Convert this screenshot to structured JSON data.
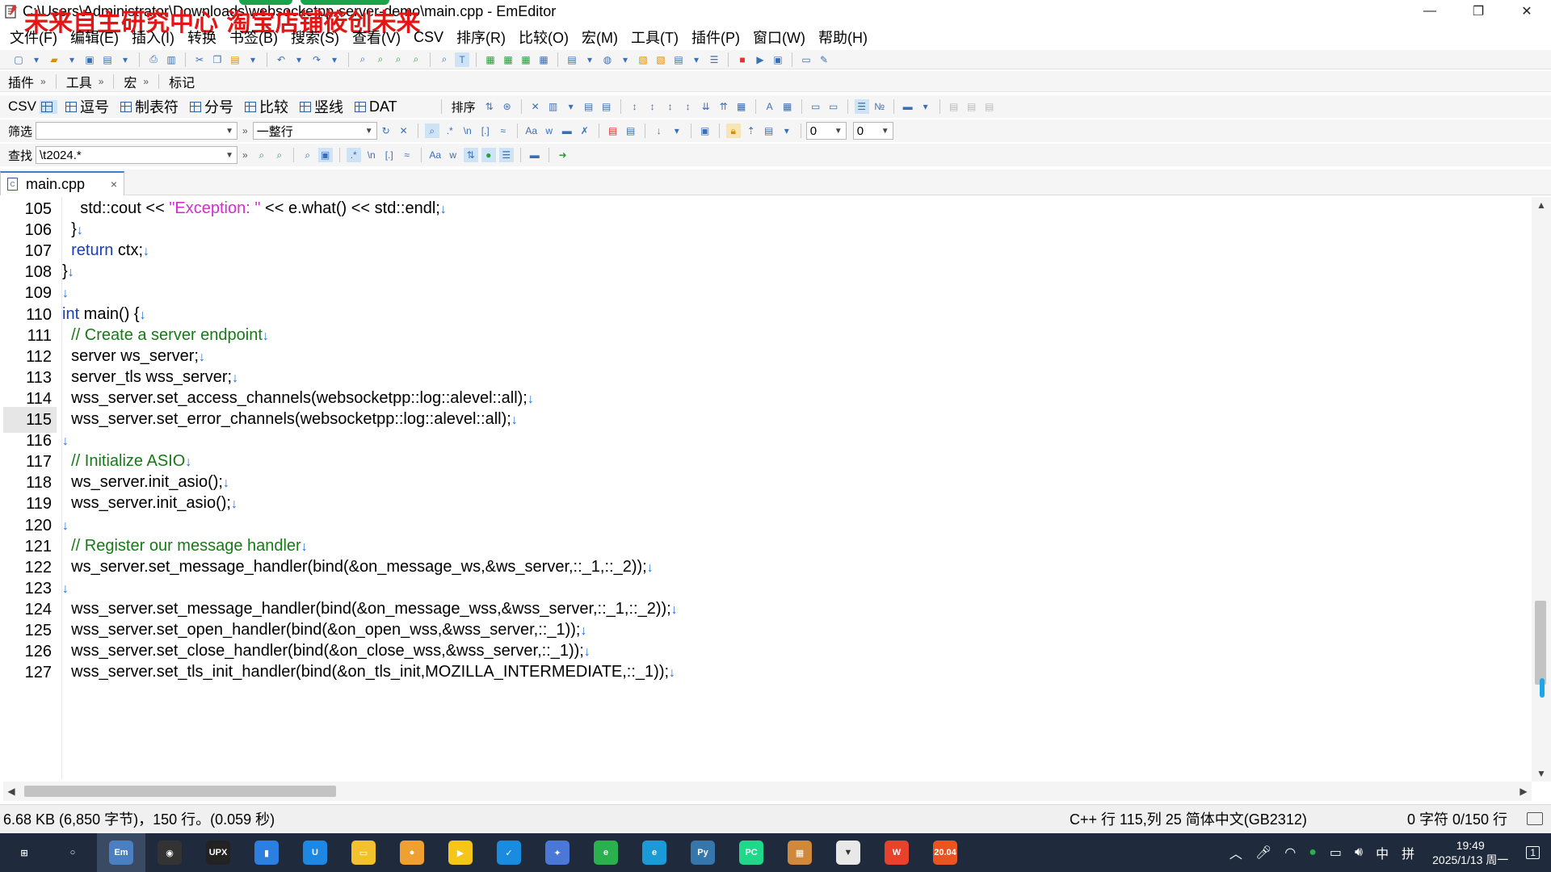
{
  "window": {
    "title": "C:\\Users\\Administrator\\Downloads\\websocketpp-server-demo\\main.cpp - EmEditor",
    "watermark": "未来自主研究中心 淘宝店铺筱创未来",
    "controls": {
      "minimize": "—",
      "restore": "❐",
      "close": "✕"
    }
  },
  "menu": [
    "文件(F)",
    "编辑(E)",
    "插入(I)",
    "转换",
    "书签(B)",
    "搜索(S)",
    "查看(V)",
    "CSV",
    "排序(R)",
    "比较(O)",
    "宏(M)",
    "工具(T)",
    "插件(P)",
    "窗口(W)",
    "帮助(H)"
  ],
  "toolbar2": {
    "plugins": "插件",
    "tools": "工具",
    "macro": "宏",
    "marks": "标记"
  },
  "csvbar": {
    "csv_label": "CSV",
    "items": [
      "逗号",
      "制表符",
      "分号",
      "比较",
      "竖线",
      "DAT"
    ],
    "sort_label": "排序"
  },
  "filter": {
    "label": "筛选",
    "value": "",
    "mode": "一整行",
    "num1": "0",
    "num2": "0"
  },
  "find": {
    "label": "查找",
    "value": "\\t2024.*"
  },
  "tab": {
    "name": "main.cpp"
  },
  "editor": {
    "current_line": "115",
    "lines": [
      {
        "num": "105",
        "indent": "    ",
        "pre": "std::cout << ",
        "str": "\"Exception: \"",
        "post": " << e.what() << std::endl;"
      },
      {
        "num": "106",
        "indent": "  ",
        "pre": "}",
        "str": "",
        "post": ""
      },
      {
        "num": "107",
        "indent": "  ",
        "kw": "return",
        "pre": " ctx;",
        "str": "",
        "post": ""
      },
      {
        "num": "108",
        "indent": "",
        "pre": "}",
        "str": "",
        "post": ""
      },
      {
        "num": "109",
        "indent": "",
        "pre": "",
        "str": "",
        "post": ""
      },
      {
        "num": "110",
        "indent": "",
        "kw": "int",
        "pre": " main() {",
        "str": "",
        "post": ""
      },
      {
        "num": "111",
        "indent": "  ",
        "cmt": "// Create a server endpoint"
      },
      {
        "num": "112",
        "indent": "  ",
        "pre": "server ws_server;"
      },
      {
        "num": "113",
        "indent": "  ",
        "pre": "server_tls wss_server;"
      },
      {
        "num": "114",
        "indent": "  ",
        "pre": "wss_server.set_access_channels(websocketpp::log::alevel::all);"
      },
      {
        "num": "115",
        "indent": "  ",
        "pre": "wss_server.set_error_channels(websocketpp::log::alevel::all);"
      },
      {
        "num": "116",
        "indent": "",
        "pre": ""
      },
      {
        "num": "117",
        "indent": "  ",
        "cmt": "// Initialize ASIO"
      },
      {
        "num": "118",
        "indent": "  ",
        "pre": "ws_server.init_asio();"
      },
      {
        "num": "119",
        "indent": "  ",
        "pre": "wss_server.init_asio();"
      },
      {
        "num": "120",
        "indent": "",
        "pre": ""
      },
      {
        "num": "121",
        "indent": "  ",
        "cmt": "// Register our message handler"
      },
      {
        "num": "122",
        "indent": "  ",
        "pre": "ws_server.set_message_handler(bind(&on_message_ws,&ws_server,::_1,::_2));"
      },
      {
        "num": "123",
        "indent": "",
        "pre": ""
      },
      {
        "num": "124",
        "indent": "  ",
        "pre": "wss_server.set_message_handler(bind(&on_message_wss,&wss_server,::_1,::_2));"
      },
      {
        "num": "125",
        "indent": "  ",
        "pre": "wss_server.set_open_handler(bind(&on_open_wss,&wss_server,::_1));"
      },
      {
        "num": "126",
        "indent": "  ",
        "pre": "wss_server.set_close_handler(bind(&on_close_wss,&wss_server,::_1));"
      },
      {
        "num": "127",
        "indent": "  ",
        "pre": "wss_server.set_tls_init_handler(bind(&on_tls_init,MOZILLA_INTERMEDIATE,::_1));"
      }
    ],
    "newline_mark": "↓"
  },
  "status": {
    "file_info": "6.68 KB (6,850 字节)，150 行。(0.059 秒)",
    "language": "C++",
    "position": "行 115,列 25",
    "encoding": "简体中文(GB2312)",
    "count": "0 字符  0/150 行"
  },
  "taskbar": {
    "apps": [
      {
        "name": "start",
        "label": "⊞",
        "color": "#1f2b3d"
      },
      {
        "name": "search",
        "label": "○",
        "color": "#1f2b3d"
      },
      {
        "name": "emeditor",
        "label": "Em",
        "color": "#4a7fc1"
      },
      {
        "name": "obs",
        "label": "◉",
        "color": "#333333"
      },
      {
        "name": "upx",
        "label": "UPX",
        "color": "#222222"
      },
      {
        "name": "notes",
        "label": "▮",
        "color": "#2a7fe0"
      },
      {
        "name": "blue-app",
        "label": "U",
        "color": "#1d87e4"
      },
      {
        "name": "explorer",
        "label": "▭",
        "color": "#f2c12e"
      },
      {
        "name": "chrome-like",
        "label": "●",
        "color": "#f0a030"
      },
      {
        "name": "player",
        "label": "▶",
        "color": "#f5c518"
      },
      {
        "name": "vscode-alt",
        "label": "✓",
        "color": "#1a8ce0"
      },
      {
        "name": "pin",
        "label": "✦",
        "color": "#4b77d6"
      },
      {
        "name": "browser-e",
        "label": "e",
        "color": "#2ab14e"
      },
      {
        "name": "edge",
        "label": "e",
        "color": "#1a9ad6"
      },
      {
        "name": "python",
        "label": "Py",
        "color": "#3776ab"
      },
      {
        "name": "pycharm",
        "label": "PC",
        "color": "#21d789"
      },
      {
        "name": "box",
        "label": "▦",
        "color": "#d0893a"
      },
      {
        "name": "vpn",
        "label": "▼",
        "color": "#e8e8e8"
      },
      {
        "name": "wps",
        "label": "W",
        "color": "#e8412c"
      },
      {
        "name": "ubuntu",
        "label": "20.04",
        "color": "#e95420"
      }
    ],
    "tray": {
      "ime": "中",
      "layout": "拼",
      "time": "19:49",
      "date": "2025/1/13 周一",
      "notifications": "1"
    }
  }
}
